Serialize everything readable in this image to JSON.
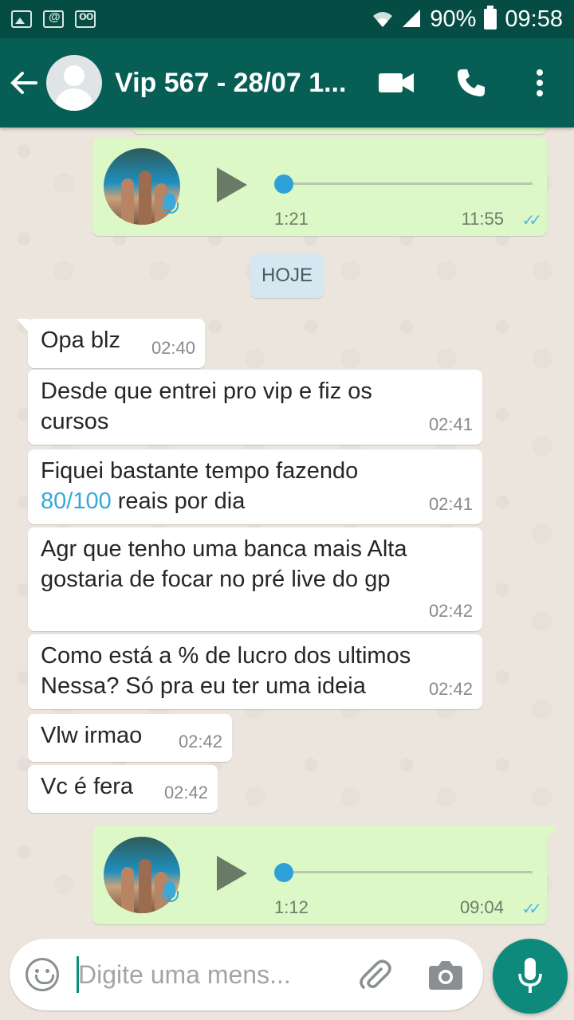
{
  "status_bar": {
    "battery": "90%",
    "time": "09:58",
    "icons": [
      "photo-icon",
      "email-icon",
      "voicemail-icon",
      "wifi-icon",
      "signal-icon",
      "battery-icon"
    ]
  },
  "header": {
    "title": "Vip 567 - 28/07 1...",
    "icons": [
      "back-arrow-icon",
      "video-call-icon",
      "phone-icon",
      "more-options-icon"
    ]
  },
  "chat": {
    "voice_notes": [
      {
        "duration": "1:21",
        "time": "11:55",
        "ticks": "✓✓"
      },
      {
        "duration": "1:12",
        "time": "09:04",
        "ticks": "✓✓"
      }
    ],
    "date_divider": "HOJE",
    "messages": [
      {
        "text": "Opa blz",
        "time": "02:40"
      },
      {
        "line1": "Desde que entrei pro vip e fiz os",
        "line2": "cursos",
        "time": "02:41"
      },
      {
        "line1": "Fiquei bastante tempo fazendo",
        "link": "80/100",
        "line2_rest": " reais por dia",
        "time": "02:41"
      },
      {
        "line1": "Agr que tenho uma banca mais Alta",
        "line2": "gostaria de focar no pré live do gp",
        "time": "02:42"
      },
      {
        "line1": "Como está a % de lucro dos ultimos",
        "line2": "Nessa? Só pra eu ter uma ideia",
        "time": "02:42"
      },
      {
        "text": "Vlw irmao",
        "time": "02:42"
      },
      {
        "text": "Vc é fera",
        "time": "02:42"
      }
    ]
  },
  "composer": {
    "placeholder": "Digite uma mens..."
  },
  "colors": {
    "header": "#075e54",
    "status_bar": "#054d44",
    "outgoing_bubble": "#dcf8c6",
    "incoming_bubble": "#ffffff",
    "fab": "#0e8a7c",
    "link": "#34a9d8"
  }
}
